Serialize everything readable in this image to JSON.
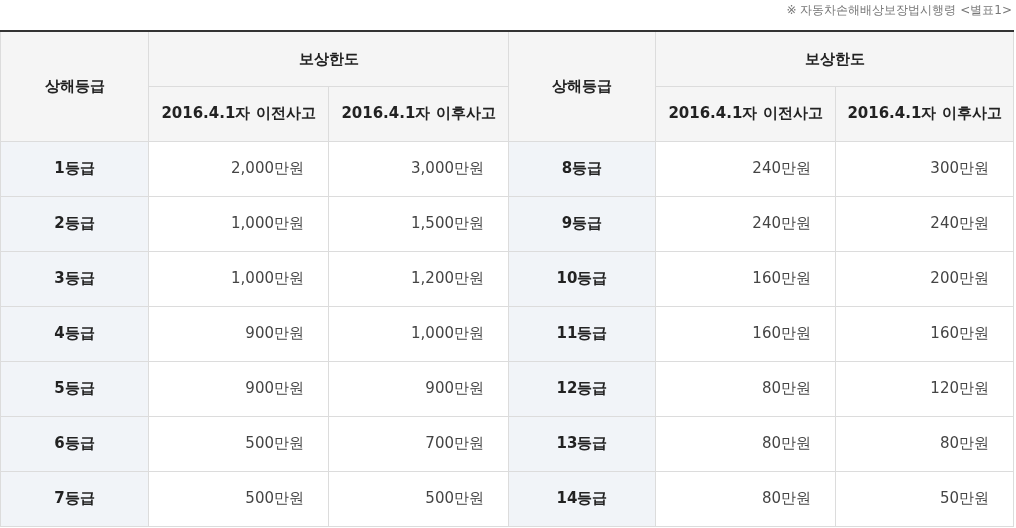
{
  "note": "※ 자동차손해배상보장법시행령 <별표1>",
  "halves": [
    {
      "grade_label": "상해등급",
      "limit_label": "보상한도",
      "before_label": "2016.4.1자 이전사고",
      "after_label": "2016.4.1자 이후사고"
    },
    {
      "grade_label": "상해등급",
      "limit_label": "보상한도",
      "before_label": "2016.4.1자 이전사고",
      "after_label": "2016.4.1자 이후사고"
    }
  ],
  "rows": [
    [
      {
        "grade": "1등급",
        "before": "2,000만원",
        "after": "3,000만원"
      },
      {
        "grade": "8등급",
        "before": "240만원",
        "after": "300만원"
      }
    ],
    [
      {
        "grade": "2등급",
        "before": "1,000만원",
        "after": "1,500만원"
      },
      {
        "grade": "9등급",
        "before": "240만원",
        "after": "240만원"
      }
    ],
    [
      {
        "grade": "3등급",
        "before": "1,000만원",
        "after": "1,200만원"
      },
      {
        "grade": "10등급",
        "before": "160만원",
        "after": "200만원"
      }
    ],
    [
      {
        "grade": "4등급",
        "before": "900만원",
        "after": "1,000만원"
      },
      {
        "grade": "11등급",
        "before": "160만원",
        "after": "160만원"
      }
    ],
    [
      {
        "grade": "5등급",
        "before": "900만원",
        "after": "900만원"
      },
      {
        "grade": "12등급",
        "before": "80만원",
        "after": "120만원"
      }
    ],
    [
      {
        "grade": "6등급",
        "before": "500만원",
        "after": "700만원"
      },
      {
        "grade": "13등급",
        "before": "80만원",
        "after": "80만원"
      }
    ],
    [
      {
        "grade": "7등급",
        "before": "500만원",
        "after": "500만원"
      },
      {
        "grade": "14등급",
        "before": "80만원",
        "after": "50만원"
      }
    ]
  ]
}
